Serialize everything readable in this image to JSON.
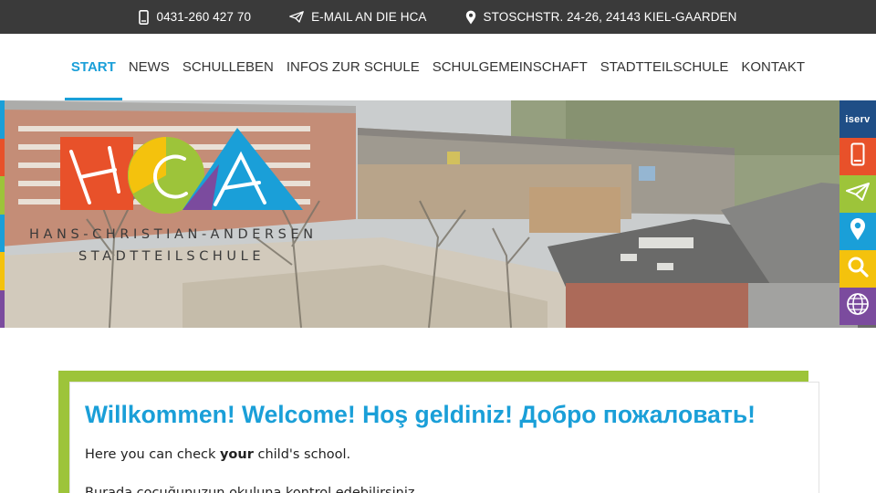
{
  "topbar": {
    "phone": "0431-260 427 70",
    "email": "E-MAIL AN DIE HCA",
    "address": "STOSCHSTR. 24-26, 24143 KIEL-GAARDEN"
  },
  "nav": {
    "items": [
      {
        "label": "START",
        "active": true
      },
      {
        "label": "NEWS"
      },
      {
        "label": "SCHULLEBEN"
      },
      {
        "label": "INFOS ZUR SCHULE"
      },
      {
        "label": "SCHULGEMEINSCHAFT"
      },
      {
        "label": "STADTTEILSCHULE"
      },
      {
        "label": "KONTAKT"
      }
    ]
  },
  "logo": {
    "letters": "HCA",
    "line1": "HANS-CHRISTIAN-ANDERSEN",
    "line2": "STADTTEILSCHULE"
  },
  "sidebar": {
    "iserv_label": "iserv",
    "items": [
      {
        "icon": "iserv-icon",
        "color": "#1f4e86"
      },
      {
        "icon": "phone-icon",
        "color": "#e8512a"
      },
      {
        "icon": "paper-plane-icon",
        "color": "#9dc43a"
      },
      {
        "icon": "location-pin-icon",
        "color": "#1a9fd8"
      },
      {
        "icon": "search-icon",
        "color": "#f4c20d"
      },
      {
        "icon": "globe-icon",
        "color": "#7b4b9e"
      }
    ]
  },
  "welcome": {
    "title": "Willkommen! Welcome! Hoş geldiniz! Добро пожаловать!",
    "line1_before": "Here you can check ",
    "line1_bold": "your",
    "line1_after": " child's school.",
    "line2": "Burada çocuğunuzun okuluna kontrol edebilirsiniz."
  },
  "colors": {
    "accent_blue": "#1a9fd8",
    "green": "#9dc43a",
    "orange": "#e8512a",
    "yellow": "#f4c20d",
    "purple": "#7b4b9e",
    "topbar": "#3a3a3a"
  }
}
